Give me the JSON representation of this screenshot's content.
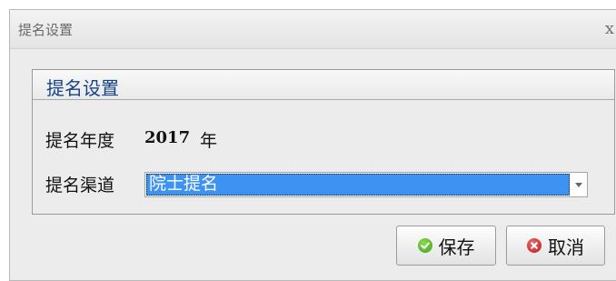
{
  "window": {
    "title": "提名设置",
    "close_glyph": "x"
  },
  "group": {
    "title": "提名设置"
  },
  "year_row": {
    "label": "提名年度",
    "value": "2017",
    "unit": "年"
  },
  "channel_row": {
    "label": "提名渠道",
    "selected": "院士提名"
  },
  "buttons": {
    "save_label": "保存",
    "cancel_label": "取消"
  },
  "icons": {
    "close": "close-icon",
    "dropdown": "chevron-down-icon",
    "save": "check-circle-icon",
    "cancel": "x-circle-icon"
  },
  "colors": {
    "selection": "#3e93f2",
    "group_title": "#15428b",
    "save_icon": "#3f9d1c",
    "cancel_icon": "#b81818"
  }
}
